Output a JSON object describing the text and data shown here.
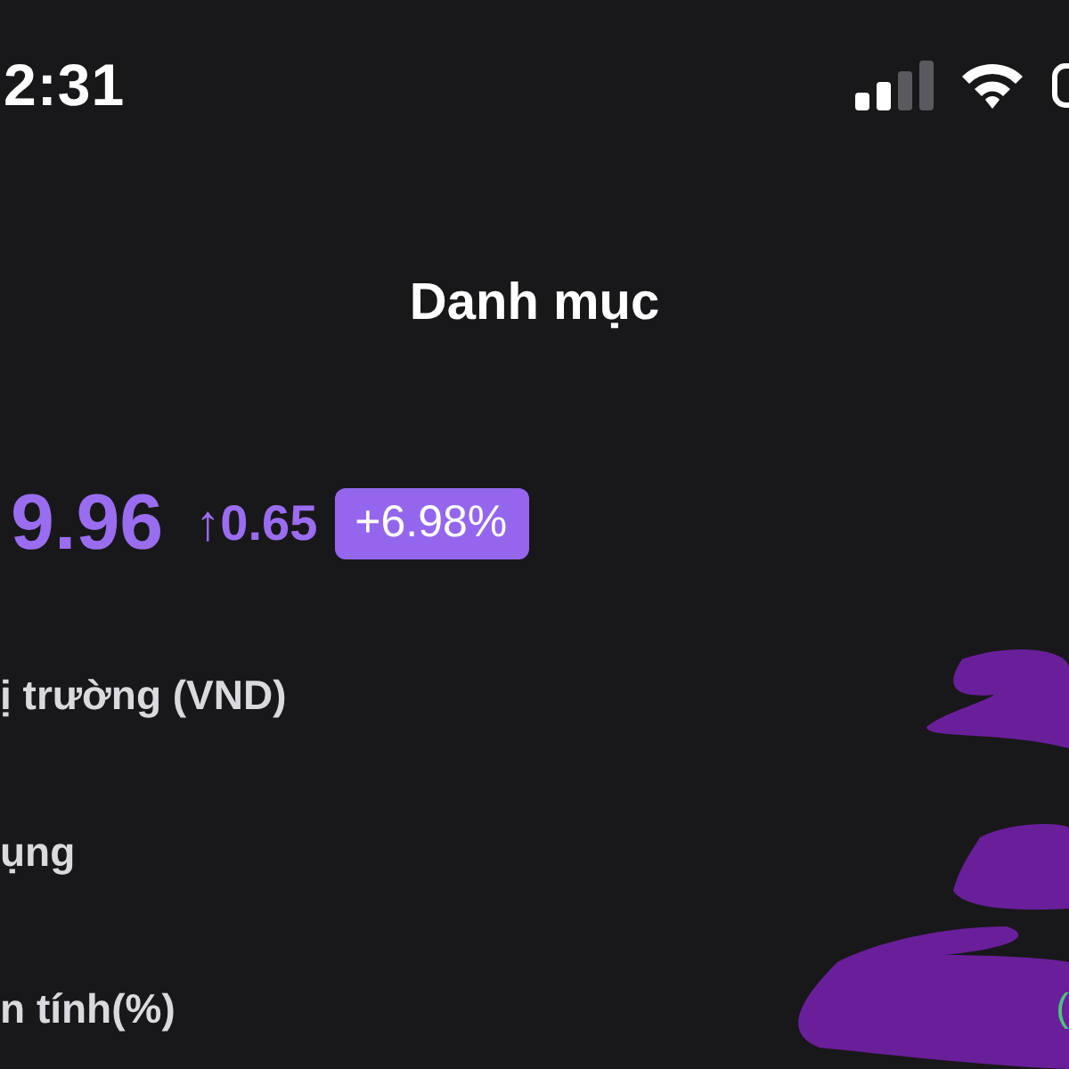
{
  "status_bar": {
    "time": "2:31"
  },
  "title": "Danh mục",
  "summary": {
    "value": "9.96",
    "change_arrow": "↑",
    "change": "0.65",
    "percent": "+6.98%"
  },
  "rows": [
    {
      "label": "ị trường (VND)"
    },
    {
      "label": "ụng"
    },
    {
      "label": "n tính(%)",
      "value": "("
    }
  ]
}
